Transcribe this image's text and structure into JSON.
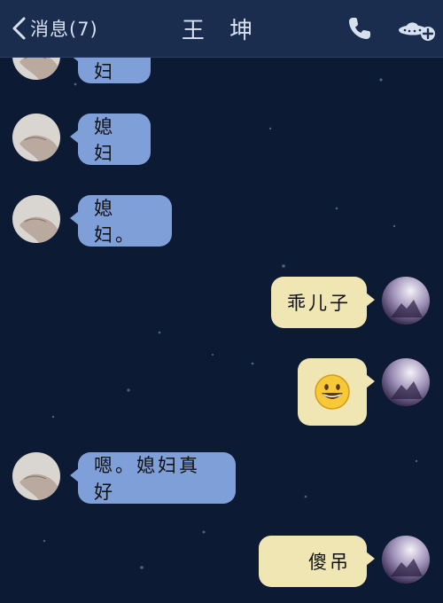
{
  "header": {
    "back_label": "消息(7)",
    "title": "王 坤"
  },
  "messages": [
    {
      "side": "in",
      "text": "媳妇"
    },
    {
      "side": "in",
      "text": "媳妇"
    },
    {
      "side": "in",
      "text": "媳妇。"
    },
    {
      "side": "out",
      "text": "乖儿子"
    },
    {
      "side": "out",
      "text": "",
      "emoji": "smiling-face-emoji"
    },
    {
      "side": "in",
      "text": "嗯。媳妇真好"
    },
    {
      "side": "out",
      "text": "傻吊"
    }
  ],
  "colors": {
    "background": "#0d1a33",
    "header": "#1b2d4f",
    "incoming_bubble": "#7f9fd8",
    "outgoing_bubble": "#efe6b3"
  }
}
